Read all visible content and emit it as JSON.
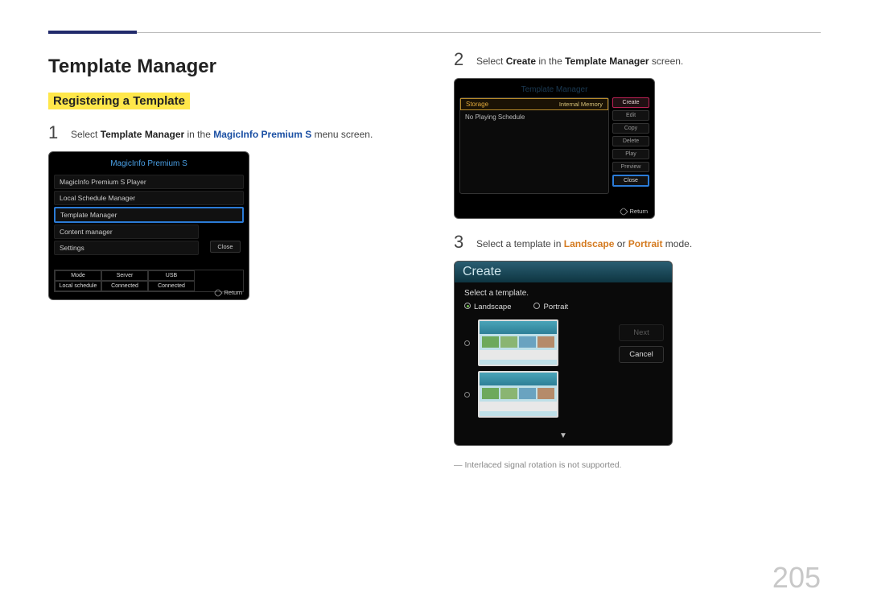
{
  "page_number": "205",
  "title": "Template Manager",
  "subheading": "Registering a Template",
  "steps": {
    "s1num": "1",
    "s1": {
      "pre": "Select ",
      "b1": "Template Manager",
      "mid": " in the ",
      "b2": "MagicInfo Premium S",
      "post": " menu screen."
    },
    "s2num": "2",
    "s2": {
      "pre": "Select ",
      "b1": "Create",
      "mid": " in the ",
      "b2": "Template Manager",
      "post": " screen."
    },
    "s3num": "3",
    "s3": {
      "pre": "Select a template in ",
      "b1": "Landscape",
      "mid": " or ",
      "b2": "Portrait",
      "post": " mode."
    }
  },
  "fig1": {
    "title": "MagicInfo Premium S",
    "items": {
      "i1": "MagicInfo Premium S Player",
      "i2": "Local Schedule Manager",
      "i3": "Template Manager",
      "i4": "Content manager",
      "i5": "Settings"
    },
    "close": "Close",
    "grid": {
      "h1": "Mode",
      "h2": "Server",
      "h3": "USB",
      "v1": "Local schedule",
      "v2": "Connected",
      "v3": "Connected"
    },
    "return": "Return"
  },
  "fig2": {
    "title": "Template Manager",
    "storage": "Storage",
    "internal": "Internal Memory",
    "nosched": "No Playing Schedule",
    "btns": {
      "create": "Create",
      "edit": "Edit",
      "copy": "Copy",
      "delete": "Delete",
      "play": "Play",
      "preview": "Preview",
      "close": "Close"
    },
    "return": "Return"
  },
  "fig3": {
    "head": "Create",
    "sub": "Select a template.",
    "landscape": "Landscape",
    "portrait": "Portrait",
    "next": "Next",
    "cancel": "Cancel"
  },
  "footnote": {
    "dash": "―",
    "text": "Interlaced signal rotation is not supported."
  }
}
